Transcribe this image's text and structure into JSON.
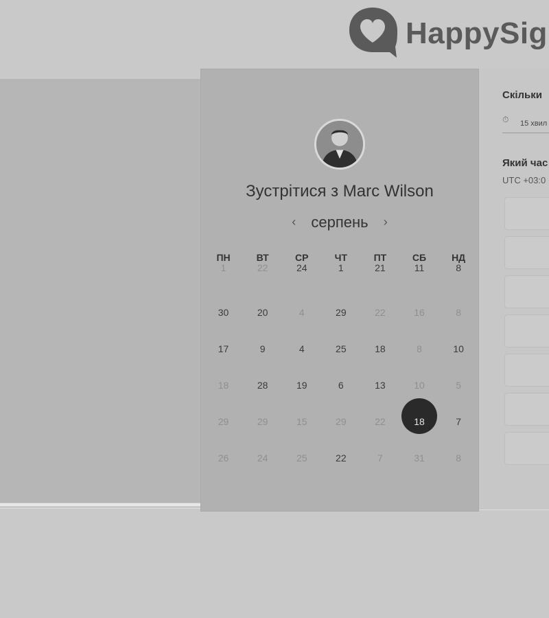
{
  "brand": {
    "name": "HappySig"
  },
  "calendar": {
    "title": "Зустрітися з Marc Wilson",
    "month": "серпень",
    "prev_label": "‹",
    "next_label": "›",
    "weekdays": [
      "ПН",
      "ВТ",
      "СР",
      "ЧТ",
      "ПТ",
      "СБ",
      "НД"
    ],
    "weeks": [
      [
        "1",
        "22",
        "24",
        "1",
        "21",
        "11",
        "8"
      ],
      [
        "30",
        "20",
        "4",
        "29",
        "22",
        "16",
        "8"
      ],
      [
        "17",
        "9",
        "4",
        "25",
        "18",
        "8",
        "10"
      ],
      [
        "18",
        "28",
        "19",
        "6",
        "13",
        "10",
        "5"
      ],
      [
        "29",
        "29",
        "15",
        "29",
        "22",
        "18",
        "7"
      ],
      [
        "26",
        "24",
        "25",
        "22",
        "7",
        "31",
        "8"
      ]
    ],
    "selected": "18"
  },
  "booking": {
    "duration_label": "Скільки",
    "duration_value": "15 хвил",
    "time_label": "Який час",
    "timezone": "UTC +03:0"
  },
  "icons": {
    "logo": "heart-speech-bubble-icon",
    "prev": "chevron-left-icon",
    "next": "chevron-right-icon",
    "duration": "clock-icon"
  },
  "colors": {
    "selected_day": "#2a2a2a"
  }
}
